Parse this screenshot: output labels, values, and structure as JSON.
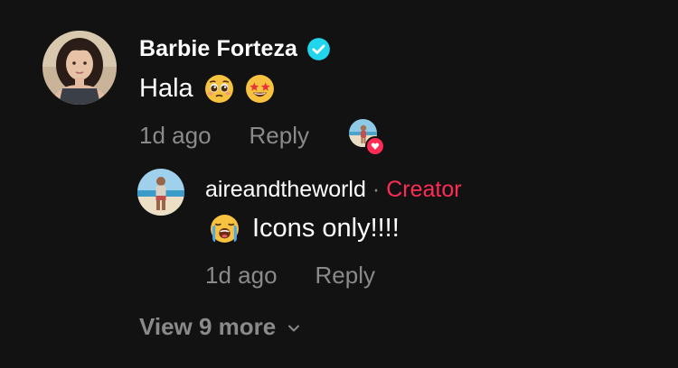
{
  "comment": {
    "author": "Barbie Forteza",
    "verified": true,
    "text": "Hala",
    "emojis": [
      "pleading-face-emoji",
      "star-struck-emoji"
    ],
    "time": "1d ago",
    "reply_label": "Reply",
    "liked_by_creator": true
  },
  "reply": {
    "author": "aireandtheworld",
    "separator": "·",
    "badge": "Creator",
    "emoji": "loudly-crying-face-emoji",
    "text": "Icons only!!!!",
    "time": "1d ago",
    "reply_label": "Reply"
  },
  "view_more": {
    "label": "View 9 more"
  },
  "colors": {
    "background": "#121212",
    "primary_text": "#ffffff",
    "secondary_text": "#8a8a8a",
    "accent": "#fe2c55",
    "verified": "#20d5ec"
  }
}
